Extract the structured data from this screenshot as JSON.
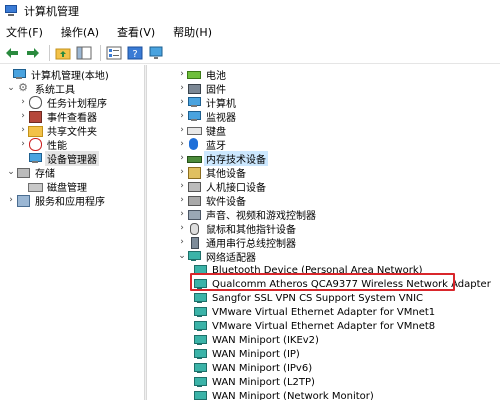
{
  "window": {
    "title": "计算机管理"
  },
  "menu": [
    "文件(F)",
    "操作(A)",
    "查看(V)",
    "帮助(H)"
  ],
  "tree_left": [
    {
      "label": "计算机管理(本地)",
      "icon": "computer-icon",
      "arrow": ""
    },
    {
      "label": "系统工具",
      "icon": "tools-icon",
      "arrow": "⌄"
    },
    {
      "label": "任务计划程序",
      "icon": "clock-icon",
      "arrow": "›"
    },
    {
      "label": "事件查看器",
      "icon": "event-viewer-icon",
      "arrow": "›"
    },
    {
      "label": "共享文件夹",
      "icon": "shared-folder-icon",
      "arrow": "›"
    },
    {
      "label": "性能",
      "icon": "performance-icon",
      "arrow": "›"
    },
    {
      "label": "设备管理器",
      "icon": "device-manager-icon",
      "arrow": ""
    },
    {
      "label": "存储",
      "icon": "storage-icon",
      "arrow": "⌄"
    },
    {
      "label": "磁盘管理",
      "icon": "disk-icon",
      "arrow": ""
    },
    {
      "label": "服务和应用程序",
      "icon": "services-icon",
      "arrow": "›"
    }
  ],
  "device_categories": [
    {
      "label": "电池",
      "icon": "battery-icon"
    },
    {
      "label": "固件",
      "icon": "firmware-icon"
    },
    {
      "label": "计算机",
      "icon": "computer-icon"
    },
    {
      "label": "监视器",
      "icon": "monitor-icon"
    },
    {
      "label": "键盘",
      "icon": "keyboard-icon"
    },
    {
      "label": "蓝牙",
      "icon": "bluetooth-icon"
    },
    {
      "label": "内存技术设备",
      "icon": "memory-icon"
    },
    {
      "label": "其他设备",
      "icon": "other-devices-icon"
    },
    {
      "label": "人机接口设备",
      "icon": "hid-icon"
    },
    {
      "label": "软件设备",
      "icon": "software-device-icon"
    },
    {
      "label": "声音、视频和游戏控制器",
      "icon": "speaker-icon"
    },
    {
      "label": "鼠标和其他指针设备",
      "icon": "mouse-icon"
    },
    {
      "label": "通用串行总线控制器",
      "icon": "usb-icon"
    },
    {
      "label": "网络适配器",
      "icon": "network-icon"
    }
  ],
  "network_adapters": [
    "Bluetooth Device (Personal Area Network)",
    "Qualcomm Atheros QCA9377 Wireless Network Adapter",
    "Sangfor SSL VPN CS Support System VNIC",
    "VMware Virtual Ethernet Adapter for VMnet1",
    "VMware Virtual Ethernet Adapter for VMnet8",
    "WAN Miniport (IKEv2)",
    "WAN Miniport (IP)",
    "WAN Miniport (IPv6)",
    "WAN Miniport (L2TP)",
    "WAN Miniport (Network Monitor)"
  ],
  "colors": {
    "highlight_border": "#d9262b",
    "selection": "#e5e5e5"
  }
}
